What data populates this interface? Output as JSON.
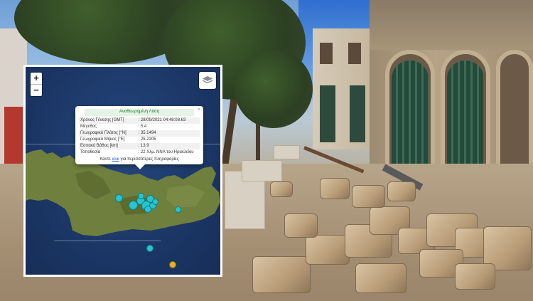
{
  "map": {
    "zoom_in": "+",
    "zoom_out": "−",
    "layers_icon": "layers-icon"
  },
  "popup": {
    "title": "Αναθεωρημένη Λύση",
    "close": "×",
    "rows": [
      {
        "label": "Χρόνος Γένεσης [GMT]",
        "value": ": 28/09/2021 04:48:08.63"
      },
      {
        "label": "Μέγεθος",
        "value": ": 5.4"
      },
      {
        "label": "Γεωγραφικό Πλάτος [°N]",
        "value": ": 35.1494"
      },
      {
        "label": "Γεωγραφικό Μήκος [°E]",
        "value": ": 25.2205"
      },
      {
        "label": "Εστιακό Βάθος [km]",
        "value": ": 13.9"
      },
      {
        "label": "Τοποθεσία",
        "value": ": 22 Χλμ. ΝΝΑ του Ηρακλείου"
      }
    ],
    "more_prefix": "Κάντε ",
    "more_link": "κλικ",
    "more_suffix": " για περισσότερες πληροφορίες"
  },
  "colors": {
    "recent_quake": "#29c4cf",
    "older_quake": "#e6b123",
    "sea": "#1d3a68",
    "land": "#6b7d3a"
  }
}
